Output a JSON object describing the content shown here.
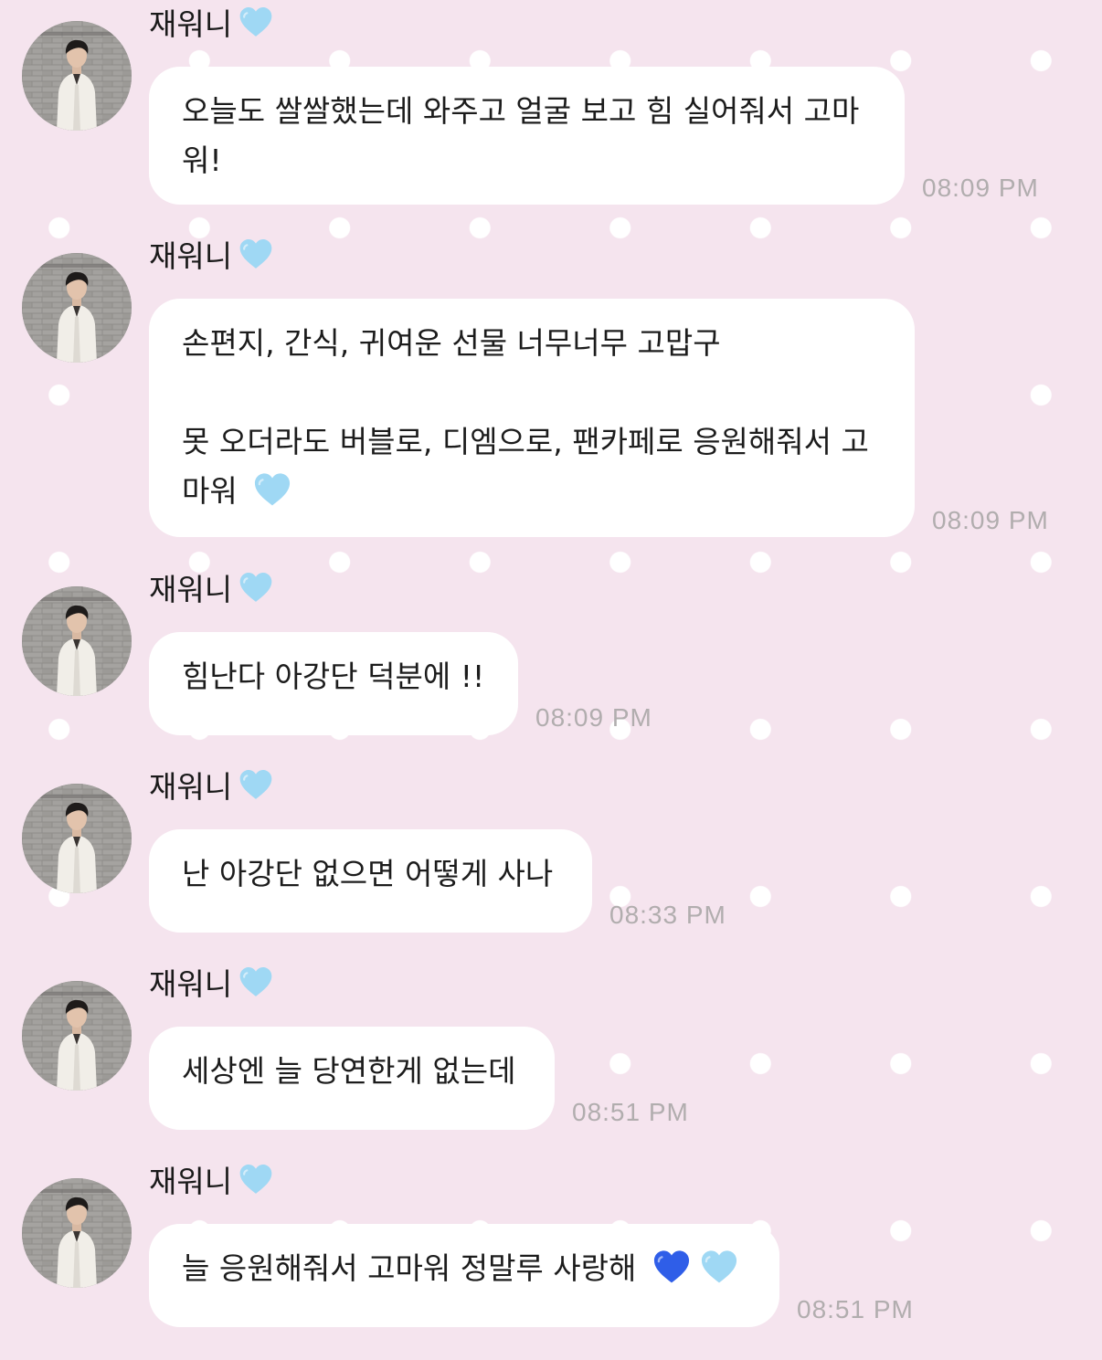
{
  "colors": {
    "background": "#f5e4ee",
    "dots": "#ffffff",
    "bubble": "#ffffff",
    "timestamp": "#b1adae",
    "light_blue_heart": "#9fd8f4",
    "blue_heart": "#2f5ee8"
  },
  "messages": [
    {
      "sender": "재워니",
      "sender_icon": "light-blue-heart-icon",
      "lines": [
        "오늘도 쌀쌀했는데 와주고 얼굴 보고 힘 실어줘서 고마",
        "워!"
      ],
      "time": "08:09 PM"
    },
    {
      "sender": "재워니",
      "sender_icon": "light-blue-heart-icon",
      "lines": [
        "손편지, 간식, 귀여운 선물 너무너무 고맙구",
        "",
        "못 오더라도 버블로, 디엠으로, 팬카페로 응원해줘서 고",
        "마워"
      ],
      "emoji_after": [
        "light-blue-heart-icon"
      ],
      "time": "08:09 PM"
    },
    {
      "sender": "재워니",
      "sender_icon": "light-blue-heart-icon",
      "lines": [
        "힘난다 아강단 덕분에 !!"
      ],
      "time": "08:09 PM"
    },
    {
      "sender": "재워니",
      "sender_icon": "light-blue-heart-icon",
      "lines": [
        "난 아강단 없으면 어떻게 사나"
      ],
      "time": "08:33 PM"
    },
    {
      "sender": "재워니",
      "sender_icon": "light-blue-heart-icon",
      "lines": [
        "세상엔 늘 당연한게 없는데"
      ],
      "time": "08:51 PM"
    },
    {
      "sender": "재워니",
      "sender_icon": "light-blue-heart-icon",
      "lines": [
        "늘 응원해줘서 고마워 정말루 사랑해"
      ],
      "emoji_after": [
        "blue-heart-icon",
        "light-blue-heart-icon"
      ],
      "time": "08:51 PM"
    }
  ]
}
